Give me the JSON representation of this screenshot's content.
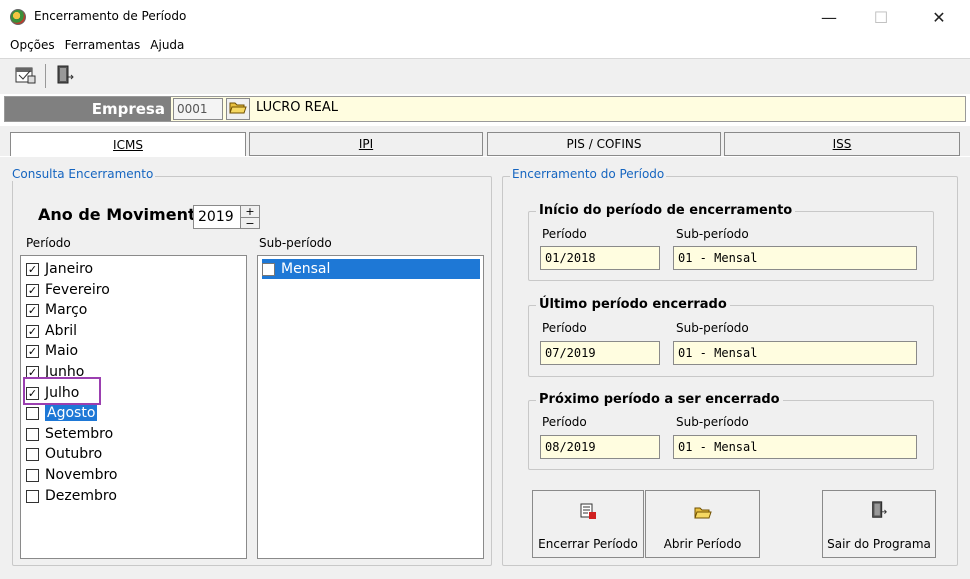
{
  "window": {
    "title": "Encerramento de Período",
    "minimize": "—",
    "maximize": "☐",
    "close": "✕"
  },
  "menu": [
    "Opções",
    "Ferramentas",
    "Ajuda"
  ],
  "empresa": {
    "label": "Empresa",
    "code": "0001",
    "name": "LUCRO REAL"
  },
  "tabs": [
    "ICMS",
    "IPI",
    "PIS / COFINS",
    "ISS"
  ],
  "consulta": {
    "legend": "Consulta Encerramento",
    "ano_label": "Ano de Movimento",
    "ano_value": "2019",
    "periodo_label": "Período",
    "subperiodo_label": "Sub-período",
    "months": [
      {
        "name": "Janeiro",
        "checked": true
      },
      {
        "name": "Fevereiro",
        "checked": true
      },
      {
        "name": "Março",
        "checked": true
      },
      {
        "name": "Abril",
        "checked": true
      },
      {
        "name": "Maio",
        "checked": true
      },
      {
        "name": "Junho",
        "checked": true
      },
      {
        "name": "Julho",
        "checked": true
      },
      {
        "name": "Agosto",
        "checked": false,
        "selected": true
      },
      {
        "name": "Setembro",
        "checked": false
      },
      {
        "name": "Outubro",
        "checked": false
      },
      {
        "name": "Novembro",
        "checked": false
      },
      {
        "name": "Dezembro",
        "checked": false
      }
    ],
    "subperiodos": [
      {
        "name": "Mensal",
        "checked": false,
        "selected": true
      }
    ]
  },
  "encerramento": {
    "legend": "Encerramento do Período",
    "inicio": {
      "title": "Início do período de encerramento",
      "periodo_label": "Período",
      "subperiodo_label": "Sub-período",
      "periodo": "01/2018",
      "subperiodo": "01 - Mensal"
    },
    "ultimo": {
      "title": "Último período encerrado",
      "periodo_label": "Período",
      "subperiodo_label": "Sub-período",
      "periodo": "07/2019",
      "subperiodo": "01 - Mensal"
    },
    "proximo": {
      "title": "Próximo período a ser encerrado",
      "periodo_label": "Período",
      "subperiodo_label": "Sub-período",
      "periodo": "08/2019",
      "subperiodo": "01 - Mensal"
    }
  },
  "buttons": {
    "encerrar": "Encerrar Período",
    "abrir": "Abrir Período",
    "sair": "Sair do Programa"
  },
  "colors": {
    "selection": "#1e78d6",
    "highlight_box": "#9b3fb0",
    "input_yellow": "#fffde0",
    "legend_blue": "#1565c0"
  }
}
